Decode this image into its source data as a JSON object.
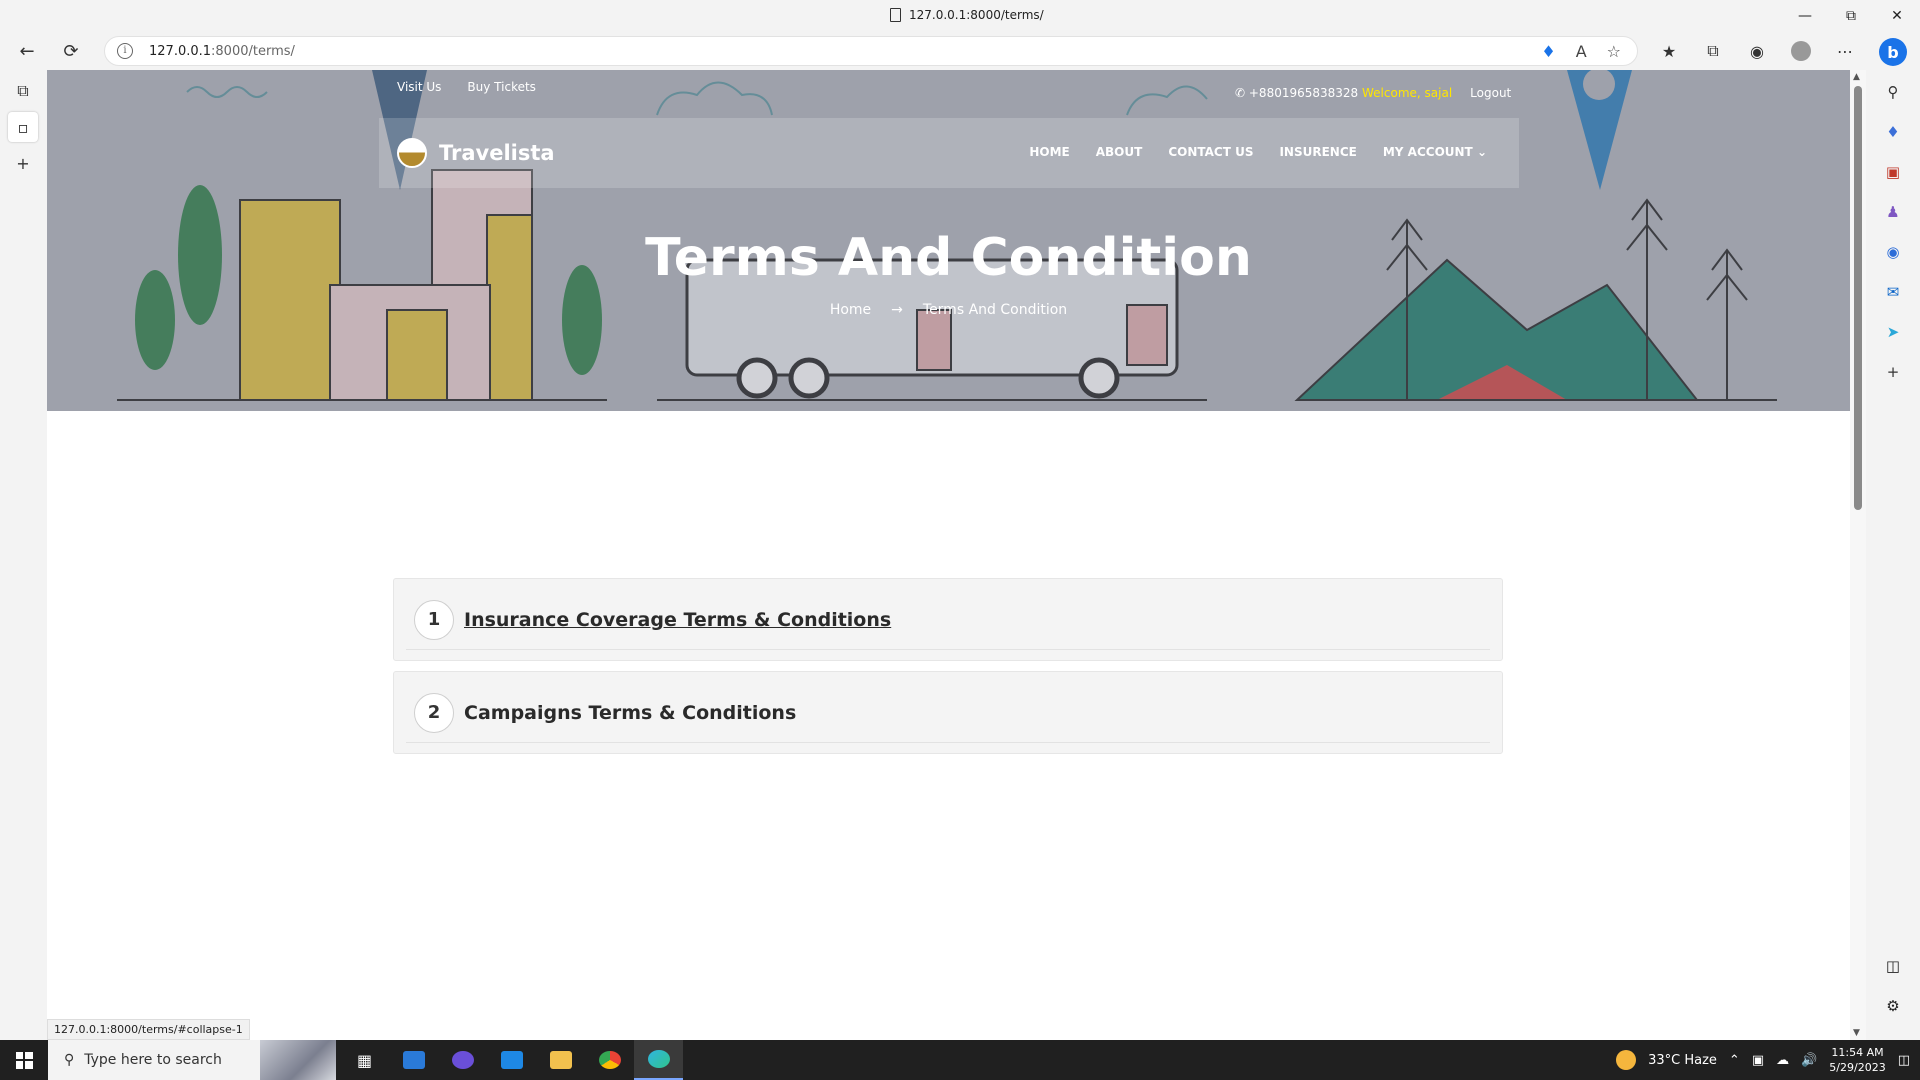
{
  "browser": {
    "tab_title": "127.0.0.1:8000/terms/",
    "url_host": "127.0.0.1",
    "url_rest": ":8000/terms/",
    "status_url": "127.0.0.1:8000/terms/#collapse-1"
  },
  "topbar": {
    "visit_us": "Visit Us",
    "buy_tickets": "Buy Tickets",
    "phone": "+8801965838328",
    "welcome": "Welcome, sajal",
    "logout": "Logout"
  },
  "nav": {
    "brand": "Travelista",
    "items": [
      "HOME",
      "ABOUT",
      "CONTACT US",
      "INSURENCE",
      "MY ACCOUNT"
    ]
  },
  "hero": {
    "title": "Terms And Condition",
    "breadcrumb_home": "Home",
    "breadcrumb_arrow": "→",
    "breadcrumb_current": "Terms And Condition"
  },
  "accordion": [
    {
      "number": "1",
      "title": "Insurance Coverage Terms & Conditions"
    },
    {
      "number": "2",
      "title": "Campaigns Terms & Conditions"
    }
  ],
  "taskbar": {
    "search_placeholder": "Type here to search",
    "weather": "33°C  Haze",
    "time": "11:54 AM",
    "date": "5/29/2023"
  },
  "colors": {
    "welcome": "#ffe600",
    "accent_blue": "#1a73e8"
  }
}
